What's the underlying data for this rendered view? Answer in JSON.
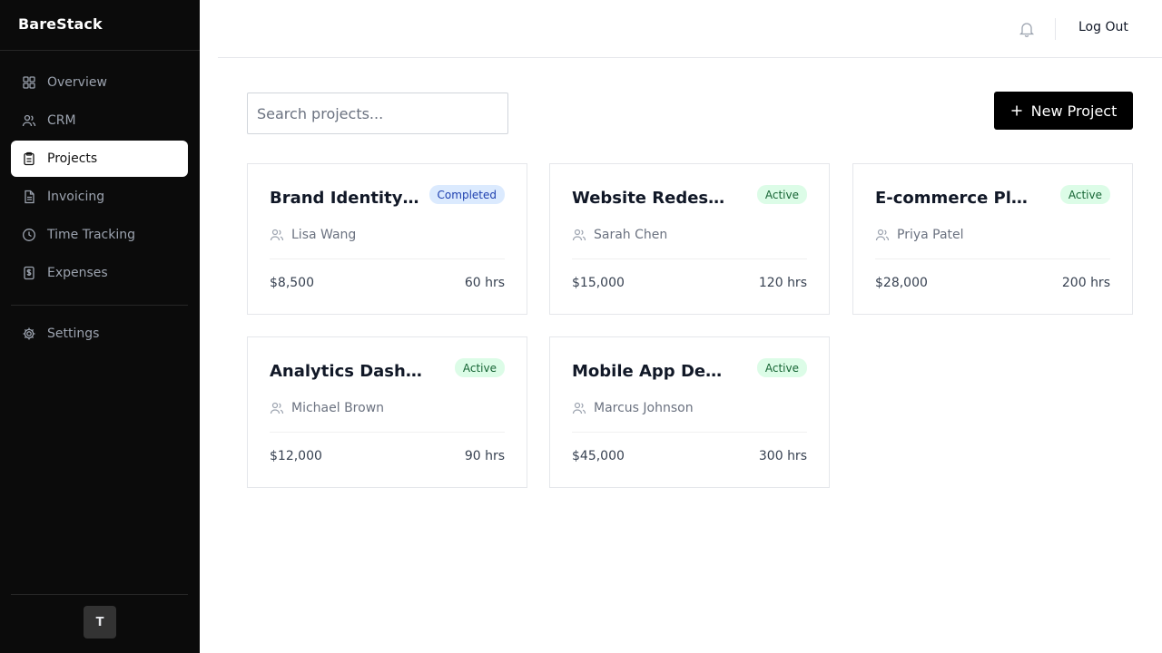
{
  "app": {
    "name": "BareStack"
  },
  "sidebar": {
    "items": [
      {
        "label": "Overview",
        "icon": "grid-icon",
        "active": false
      },
      {
        "label": "CRM",
        "icon": "users-icon",
        "active": false
      },
      {
        "label": "Projects",
        "icon": "clipboard-icon",
        "active": true
      },
      {
        "label": "Invoicing",
        "icon": "file-text-icon",
        "active": false
      },
      {
        "label": "Time Tracking",
        "icon": "clock-icon",
        "active": false
      },
      {
        "label": "Expenses",
        "icon": "dollar-receipt-icon",
        "active": false
      }
    ],
    "settings": {
      "label": "Settings",
      "icon": "gear-icon"
    },
    "avatar_initial": "T"
  },
  "header": {
    "notifications_icon": "bell-icon",
    "logout_label": "Log Out"
  },
  "toolbar": {
    "search_placeholder": "Search projects...",
    "search_value": "",
    "new_project_label": "New Project"
  },
  "projects": [
    {
      "title": "Brand Identity ...",
      "status": "Completed",
      "client": "Lisa Wang",
      "budget": "$8,500",
      "hours": "60 hrs"
    },
    {
      "title": "Website Redesign",
      "status": "Active",
      "client": "Sarah Chen",
      "budget": "$15,000",
      "hours": "120 hrs"
    },
    {
      "title": "E-commerce Platf...",
      "status": "Active",
      "client": "Priya Patel",
      "budget": "$28,000",
      "hours": "200 hrs"
    },
    {
      "title": "Analytics Dashbo...",
      "status": "Active",
      "client": "Michael Brown",
      "budget": "$12,000",
      "hours": "90 hrs"
    },
    {
      "title": "Mobile App Devel...",
      "status": "Active",
      "client": "Marcus Johnson",
      "budget": "$45,000",
      "hours": "300 hrs"
    }
  ],
  "colors": {
    "sidebar_bg": "#0b0b0b",
    "active_badge_bg": "#dcfce7",
    "active_badge_text": "#166534",
    "completed_badge_bg": "#dbeafe",
    "completed_badge_text": "#1e40af",
    "primary_button": "#000000"
  }
}
